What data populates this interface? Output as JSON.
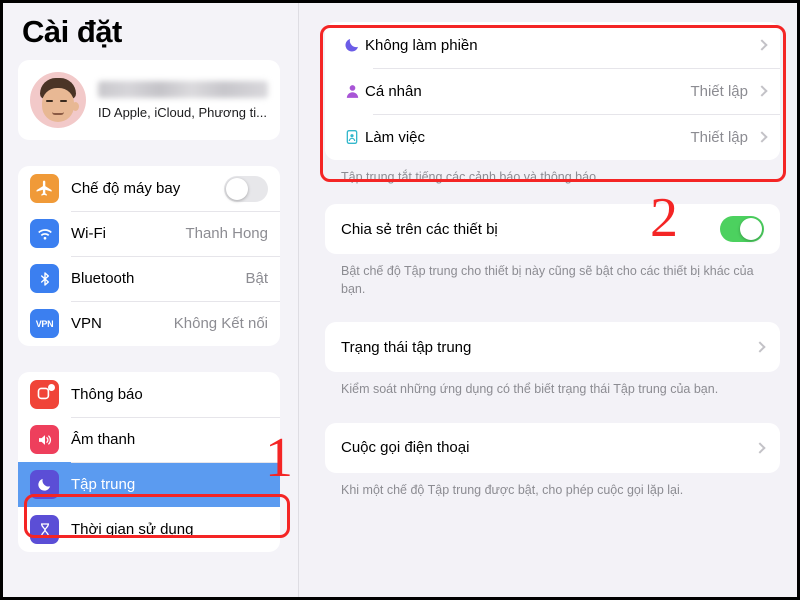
{
  "sidebar": {
    "title": "Cài đặt",
    "apple_id": {
      "name_blurred": true,
      "subtitle": "ID Apple, iCloud, Phương ti..."
    },
    "group1": [
      {
        "label": "Chế độ máy bay",
        "icon": "airplane-icon",
        "control": "toggle",
        "toggle_on": false,
        "color": "#f09a38"
      },
      {
        "label": "Wi-Fi",
        "icon": "wifi-icon",
        "value": "Thanh Hong",
        "color": "#3b7ff0"
      },
      {
        "label": "Bluetooth",
        "icon": "bluetooth-icon",
        "value": "Bật",
        "color": "#3b7ff0"
      },
      {
        "label": "VPN",
        "icon": "vpn-icon",
        "value": "Không Kết nối",
        "color": "#3b7ff0"
      }
    ],
    "group2": [
      {
        "label": "Thông báo",
        "icon": "notifications-icon",
        "color": "#f04438"
      },
      {
        "label": "Âm thanh",
        "icon": "sound-icon",
        "color": "#ee3f5c"
      },
      {
        "label": "Tập trung",
        "icon": "moon-icon",
        "color": "#5b4ed6",
        "selected": true
      },
      {
        "label": "Thời gian sử dụng",
        "icon": "hourglass-icon",
        "color": "#5b4ed6"
      }
    ]
  },
  "detail": {
    "focus_modes": [
      {
        "label": "Không làm phiền",
        "icon": "moon-icon",
        "value": "",
        "color": "#6b5ce7"
      },
      {
        "label": "Cá nhân",
        "icon": "person-icon",
        "value": "Thiết lập",
        "color": "#a855d6"
      },
      {
        "label": "Làm việc",
        "icon": "id-badge-icon",
        "value": "Thiết lập",
        "color": "#35b8cc"
      }
    ],
    "focus_footnote": "Tập trung tắt tiếng các cảnh báo và thông báo.",
    "share_across_devices": {
      "label": "Chia sẻ trên các thiết bị",
      "toggle_on": true,
      "footnote": "Bật chế độ Tập trung cho thiết bị này cũng sẽ bật cho các thiết bị khác của bạn."
    },
    "focus_status": {
      "label": "Trạng thái tập trung",
      "footnote": "Kiểm soát những ứng dụng có thể biết trạng thái Tập trung của bạn."
    },
    "phone_calls": {
      "label": "Cuộc gọi điện thoại",
      "footnote": "Khi một chế độ Tập trung được bật, cho phép cuộc gọi lặp lại."
    }
  },
  "annotations": {
    "marker_one": "1",
    "marker_two": "2",
    "accent_color": "#f42525"
  }
}
